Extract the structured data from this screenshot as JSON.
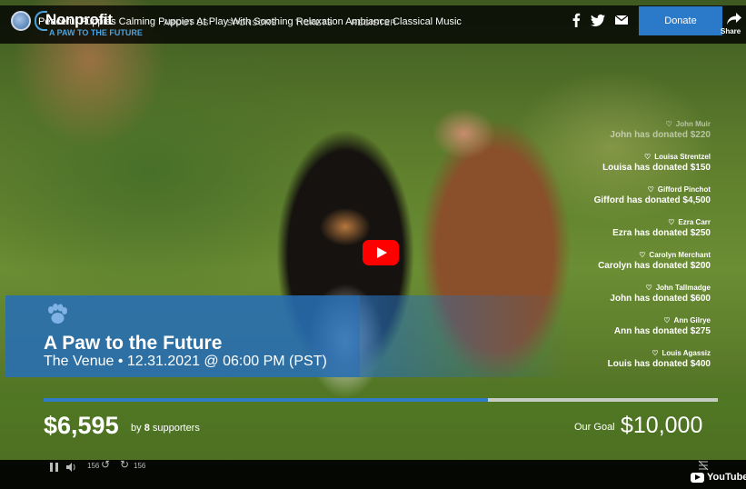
{
  "topbar": {
    "brand_name": "Nonprofit",
    "brand_suffix": "",
    "brand_tagline": "A PAW TO THE FUTURE",
    "video_title": "Peaceful Puppies Calming Puppies At Play With Soothing Relaxation Ambiance Classical Music",
    "nav": [
      "ABOUT US",
      "SPONSORS",
      "TICKETS",
      "REGISTER"
    ],
    "donate_label": "Donate",
    "share_label": "Share"
  },
  "donors": [
    {
      "name": "John Muir",
      "message": "John has donated $220"
    },
    {
      "name": "Louisa Strentzel",
      "message": "Louisa has donated $150"
    },
    {
      "name": "Gifford Pinchot",
      "message": "Gifford has donated $4,500"
    },
    {
      "name": "Ezra Carr",
      "message": "Ezra has donated $250"
    },
    {
      "name": "Carolyn Merchant",
      "message": "Carolyn has donated $200"
    },
    {
      "name": "John Tallmadge",
      "message": "John has donated $600"
    },
    {
      "name": "Ann Gilrye",
      "message": "Ann has donated $275"
    },
    {
      "name": "Louis Agassiz",
      "message": "Louis has donated $400"
    }
  ],
  "event": {
    "title": "A Paw to the Future",
    "meta": "The Venue • 12.31.2021 @ 06:00 PM (PST)"
  },
  "fundraising": {
    "raised": "$6,595",
    "by_prefix": "by",
    "supporters_count": "8",
    "supporters_suffix": "supporters",
    "goal_label": "Our Goal",
    "goal": "$10,000",
    "progress_fraction": 0.6595
  },
  "player": {
    "rewind_label": "156",
    "forward_label": "156",
    "youtube_label": "YouTube"
  },
  "colors": {
    "accent": "#2a7ac9",
    "banner": "#286eb4",
    "play": "#ff0000"
  }
}
